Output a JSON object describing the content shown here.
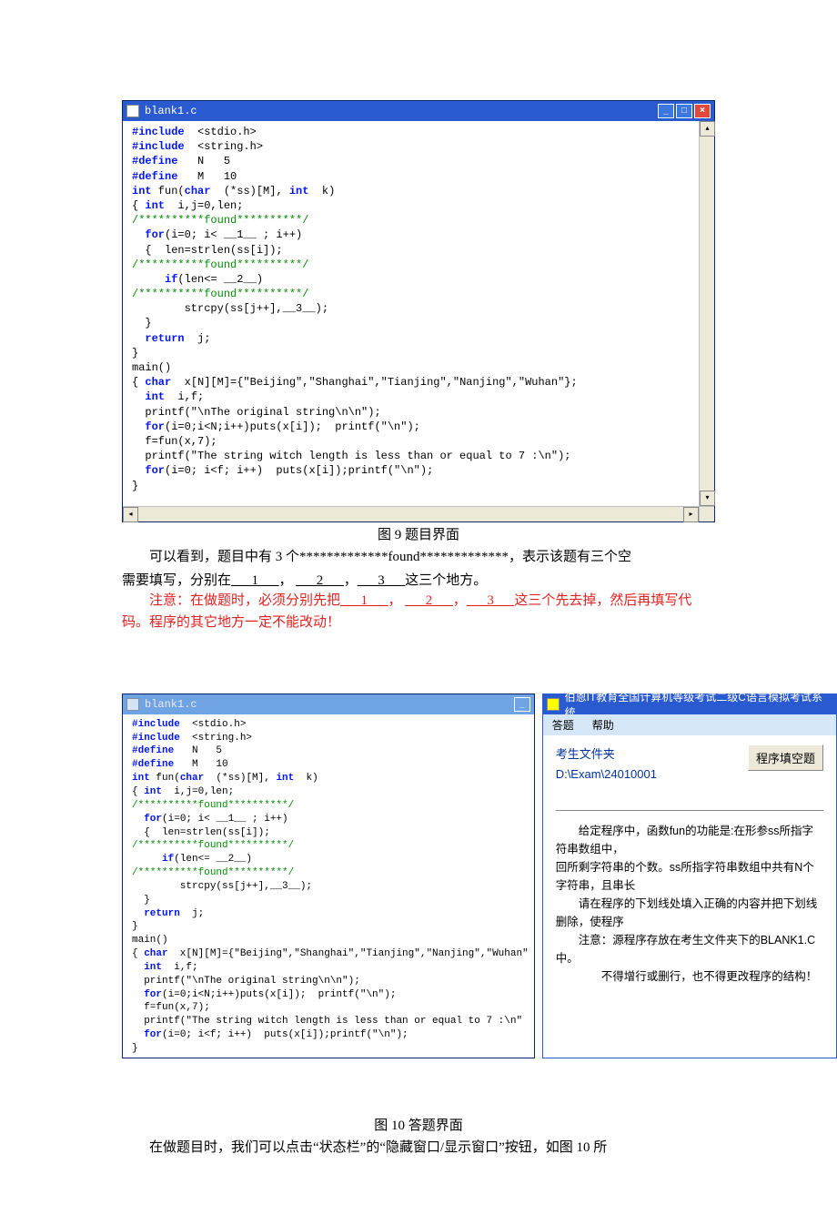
{
  "fig9": {
    "title": "blank1.c",
    "caption": "图 9  题目界面",
    "winbtn_min": "_",
    "winbtn_max": "□",
    "winbtn_close": "×",
    "scroll_up": "▴",
    "scroll_down": "▾",
    "scroll_left": "◂",
    "scroll_right": "▸",
    "code": {
      "l1a": "#include",
      "l1b": "  <stdio.h>",
      "l2a": "#include",
      "l2b": "  <string.h>",
      "l3a": "#define",
      "l3b": "   N   5",
      "l4a": "#define",
      "l4b": "   M   10",
      "l5a": "int",
      "l5b": " fun(",
      "l5c": "char",
      "l5d": "  (*ss)[M], ",
      "l5e": "int",
      "l5f": "  k)",
      "l6a": "{ ",
      "l6b": "int",
      "l6c": "  i,j=0,len;",
      "l7": "/**********found**********/",
      "l8a": "  for",
      "l8b": "(i=0; i< __1__ ; i++)",
      "l9": "  {  len=strlen(ss[i]);",
      "l10": "/**********found**********/",
      "l11a": "     if",
      "l11b": "(len<= __2__)",
      "l12": "/**********found**********/",
      "l13": "        strcpy(ss[j++],__3__);",
      "l14": "  }",
      "l15a": "  return",
      "l15b": "  j;",
      "l16": "}",
      "l17": "main()",
      "l18a": "{ ",
      "l18b": "char",
      "l18c": "  x[N][M]={\"Beijing\",\"Shanghai\",\"Tianjing\",\"Nanjing\",\"Wuhan\"};",
      "l19a": "  int",
      "l19b": "  i,f;",
      "l20": "  printf(\"\\nThe original string\\n\\n\");",
      "l21a": "  for",
      "l21b": "(i=0;i<N;i++)puts(x[i]);  printf(\"\\n\");",
      "l22": "  f=fun(x,7);",
      "l23": "  printf(\"The string witch length is less than or equal to 7 :\\n\");",
      "l24a": "  for",
      "l24b": "(i=0; i<f; i++)  puts(x[i]);printf(\"\\n\");",
      "l25": "}"
    }
  },
  "body": {
    "p1a": "可以看到，题目中有 3 个*************found*************，表示该题有三个空",
    "p1b": "需要填写，分别在",
    "b1": "___1___",
    "p1c": "，",
    "b2": "___2___",
    "p1d": "，",
    "b3": "___3___",
    "p1e": "这三个地方。",
    "warn_lead": "注意：",
    "warn_a": "在做题时，必须分别先把",
    "warn_b1": "___1___",
    "warn_c1": "，",
    "warn_b2": "___2___",
    "warn_c2": "，",
    "warn_b3": "___3___",
    "warn_d": "这三个先去掉，然后再填写代码。程序的其它地方一定不能改动！",
    "p_last": "在做题目时，我们可以点击“状态栏”的“隐藏窗口/显示窗口”按钮，如图 10 所"
  },
  "fig10": {
    "caption": "图 10  答题界面",
    "editor_title": "blank1.c",
    "editor_min": "_",
    "app_title": "伯恩IT教育全国计算机等级考试二级C语言模拟考试系统",
    "menu": {
      "m1": "答题",
      "m2": "帮助"
    },
    "folder_label": "考生文件夹",
    "folder_path": "D:\\Exam\\24010001",
    "button": "程序填空题",
    "instr1": "给定程序中，函数fun的功能是:在形参ss所指字符串数组中，",
    "instr2": "回所剩字符串的个数。ss所指字符串数组中共有N个字符串，且串长",
    "instr3": "请在程序的下划线处填入正确的内容并把下划线删除，使程序",
    "instr4": "注意：源程序存放在考生文件夹下的BLANK1.C中。",
    "instr5": "不得增行或删行，也不得更改程序的结构！",
    "code": {
      "l1a": "#include",
      "l1b": "  <stdio.h>",
      "l2a": "#include",
      "l2b": "  <string.h>",
      "l3a": "#define",
      "l3b": "   N   5",
      "l4a": "#define",
      "l4b": "   M   10",
      "l5a": "int",
      "l5b": " fun(",
      "l5c": "char",
      "l5d": "  (*ss)[M], ",
      "l5e": "int",
      "l5f": "  k)",
      "l6a": "{ ",
      "l6b": "int",
      "l6c": "  i,j=0,len;",
      "l7": "/**********found**********/",
      "l8a": "  for",
      "l8b": "(i=0; i< __1__ ; i++)",
      "l9": "  {  len=strlen(ss[i]);",
      "l10": "/**********found**********/",
      "l11a": "     if",
      "l11b": "(len<= __2__)",
      "l12": "/**********found**********/",
      "l13": "        strcpy(ss[j++],__3__);",
      "l14": "  }",
      "l15a": "  return",
      "l15b": "  j;",
      "l16": "}",
      "l17": "main()",
      "l18a": "{ ",
      "l18b": "char",
      "l18c": "  x[N][M]={\"Beijing\",\"Shanghai\",\"Tianjing\",\"Nanjing\",\"Wuhan\"",
      "l19a": "  int",
      "l19b": "  i,f;",
      "l20": "  printf(\"\\nThe original string\\n\\n\");",
      "l21a": "  for",
      "l21b": "(i=0;i<N;i++)puts(x[i]);  printf(\"\\n\");",
      "l22": "  f=fun(x,7);",
      "l23": "  printf(\"The string witch length is less than or equal to 7 :\\n\"",
      "l24a": "  for",
      "l24b": "(i=0; i<f; i++)  puts(x[i]);printf(\"\\n\");",
      "l25": "}"
    }
  }
}
